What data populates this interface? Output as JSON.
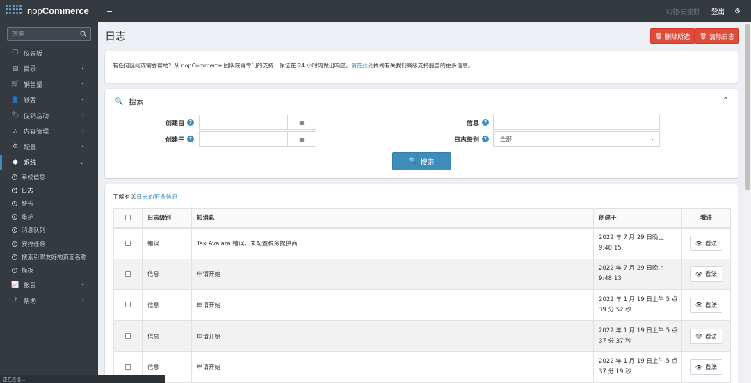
{
  "brand": {
    "text_light": "nop",
    "text_bold": "Commerce"
  },
  "sidebar": {
    "search_placeholder": "搜索",
    "items": [
      {
        "label": "仪表板",
        "icon": "monitor-icon",
        "glyph": "🖵",
        "has_children": false
      },
      {
        "label": "目录",
        "icon": "book-icon",
        "glyph": "▤",
        "has_children": true
      },
      {
        "label": "销售量",
        "icon": "cart-icon",
        "glyph": "🛒",
        "has_children": true
      },
      {
        "label": "顾客",
        "icon": "user-icon",
        "glyph": "👤",
        "has_children": true
      },
      {
        "label": "促销活动",
        "icon": "tags-icon",
        "glyph": "🏷",
        "has_children": true
      },
      {
        "label": "内容管理",
        "icon": "sitemap-icon",
        "glyph": "⛬",
        "has_children": true
      },
      {
        "label": "配置",
        "icon": "cogs-icon",
        "glyph": "⚙",
        "has_children": true
      },
      {
        "label": "系统",
        "icon": "cube-icon",
        "glyph": "⬢",
        "has_children": true,
        "expanded": true
      }
    ],
    "system_subitems": [
      {
        "label": "系统信息"
      },
      {
        "label": "日志",
        "active": true
      },
      {
        "label": "警告"
      },
      {
        "label": "维护"
      },
      {
        "label": "消息队列"
      },
      {
        "label": "安排任务"
      },
      {
        "label": "搜索引擎友好的页面名称"
      },
      {
        "label": "模板"
      }
    ],
    "items_after": [
      {
        "label": "报告",
        "icon": "chart-icon",
        "glyph": "📈",
        "has_children": true
      },
      {
        "label": "帮助",
        "icon": "question-icon",
        "glyph": "?",
        "has_children": true
      }
    ]
  },
  "topbar": {
    "menu_glyph": "≡",
    "user": "约翰·史密斯",
    "logout": "登出",
    "settings_glyph": "⚙"
  },
  "page": {
    "title": "日志",
    "delete_selected": "删除所选",
    "clear_log": "清除日志"
  },
  "info": {
    "text_before": "有任何疑问或需要帮助？从 nopCommerce 团队获得专门的支持，保证在 24 小时内做出响应。",
    "link_text": "请在此处",
    "text_after": "找到有关我们高级支持服务的更多信息。"
  },
  "search": {
    "title": "搜索",
    "created_from_label": "创建自",
    "created_to_label": "创建于",
    "message_label": "信息",
    "log_level_label": "日志级别",
    "log_level_value": "全部",
    "calendar_glyph": "▦",
    "button_label": "搜索"
  },
  "grid": {
    "learn_prefix": "了解有关",
    "learn_link": "日志的更多信息",
    "headers": {
      "level": "日志级别",
      "short_message": "短消息",
      "created_on": "创建于",
      "view": "看法"
    },
    "rows": [
      {
        "level": "错误",
        "short_message": "Tax.Avalara 错误。未配置税务提供商",
        "created_line1": "2022 年 7 月 29 日晚上",
        "created_line2": "9:48:15",
        "view": "看法"
      },
      {
        "level": "信息",
        "short_message": "申请开始",
        "created_line1": "2022 年 7 月 29 日晚上",
        "created_line2": "9:48:13",
        "view": "看法"
      },
      {
        "level": "信息",
        "short_message": "申请开始",
        "created_line1": "2022 年 1 月 19 日上午 5 点",
        "created_line2": "39 分 52 秒",
        "view": "看法"
      },
      {
        "level": "信息",
        "short_message": "申请开始",
        "created_line1": "2022 年 1 月 19 日上午 5 点",
        "created_line2": "37 分 37 秒",
        "view": "看法"
      },
      {
        "level": "信息",
        "short_message": "申请开始",
        "created_line1": "2022 年 1 月 19 日上午 5 点",
        "created_line2": "37 分 19 秒",
        "view": "看法"
      }
    ]
  },
  "status_bar": {
    "text": "正在连接..."
  },
  "colors": {
    "accent": "#3c8dbc",
    "danger": "#dd4b39",
    "sidebar": "#343a40"
  }
}
